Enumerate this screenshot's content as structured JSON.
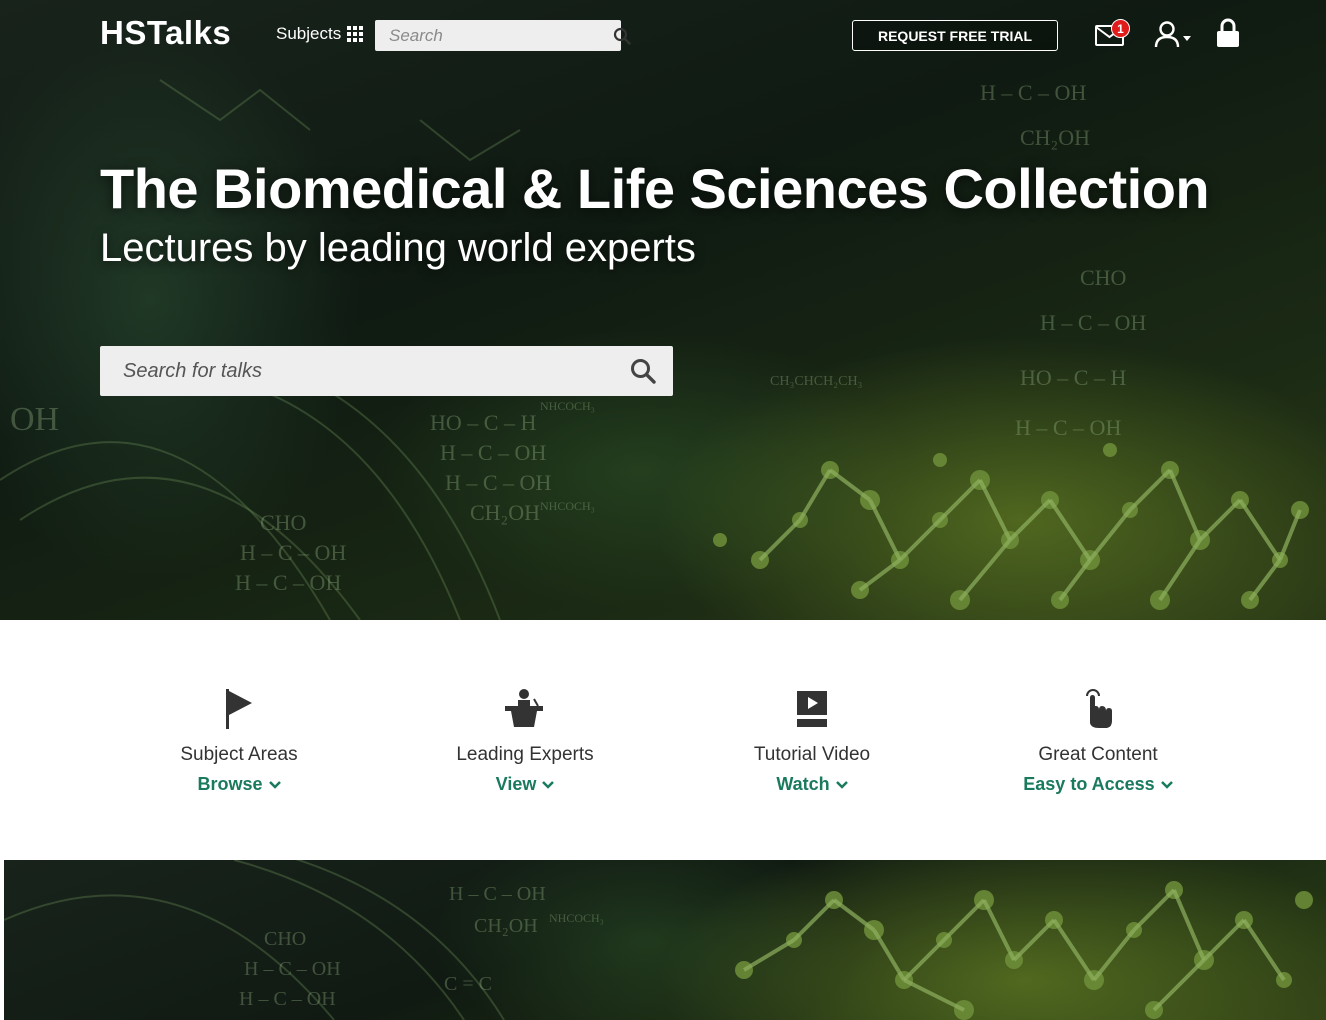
{
  "header": {
    "logo": "HSTalks",
    "subjects_label": "Subjects",
    "search_placeholder": "Search",
    "trial_button": "REQUEST FREE TRIAL",
    "mail_badge": "1"
  },
  "hero": {
    "title": "The Biomedical & Life Sciences Collection",
    "subtitle": "Lectures by leading world experts",
    "search_placeholder": "Search for talks"
  },
  "features": [
    {
      "icon": "flag-icon",
      "title": "Subject Areas",
      "link": "Browse"
    },
    {
      "icon": "speaker-podium-icon",
      "title": "Leading Experts",
      "link": "View"
    },
    {
      "icon": "video-play-icon",
      "title": "Tutorial Video",
      "link": "Watch"
    },
    {
      "icon": "tap-hand-icon",
      "title": "Great Content",
      "link": "Easy to Access"
    }
  ],
  "colors": {
    "accent_link": "#1a7a5e",
    "badge": "#e01b1b",
    "hero_bg": "#0f1a12"
  }
}
